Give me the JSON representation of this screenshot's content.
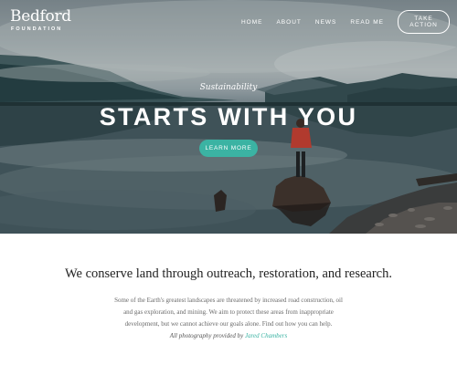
{
  "brand": {
    "name": "Bedford",
    "tagline": "FOUNDATION"
  },
  "nav": {
    "links": [
      "HOME",
      "ABOUT",
      "NEWS",
      "READ ME"
    ],
    "cta": "TAKE ACTION"
  },
  "hero": {
    "kicker": "Sustainability",
    "title": "STARTS WITH YOU",
    "button": "LEARN MORE",
    "image": "lake-mountains-person-on-stump"
  },
  "content": {
    "headline": "We conserve land through outreach, restoration, and research.",
    "body": "Some of the Earth's greatest landscapes are threatened by increased road construction, oil and gas exploration, and mining. We aim to protect these areas from inappropriate development, but we cannot achieve our goals alone. Find out how you can help.",
    "credit_prefix": "All photography provided by",
    "credit_name": "Jared Chambers"
  },
  "colors": {
    "accent": "#3bb3a3",
    "text": "#222222",
    "muted": "#6a6a6a"
  }
}
